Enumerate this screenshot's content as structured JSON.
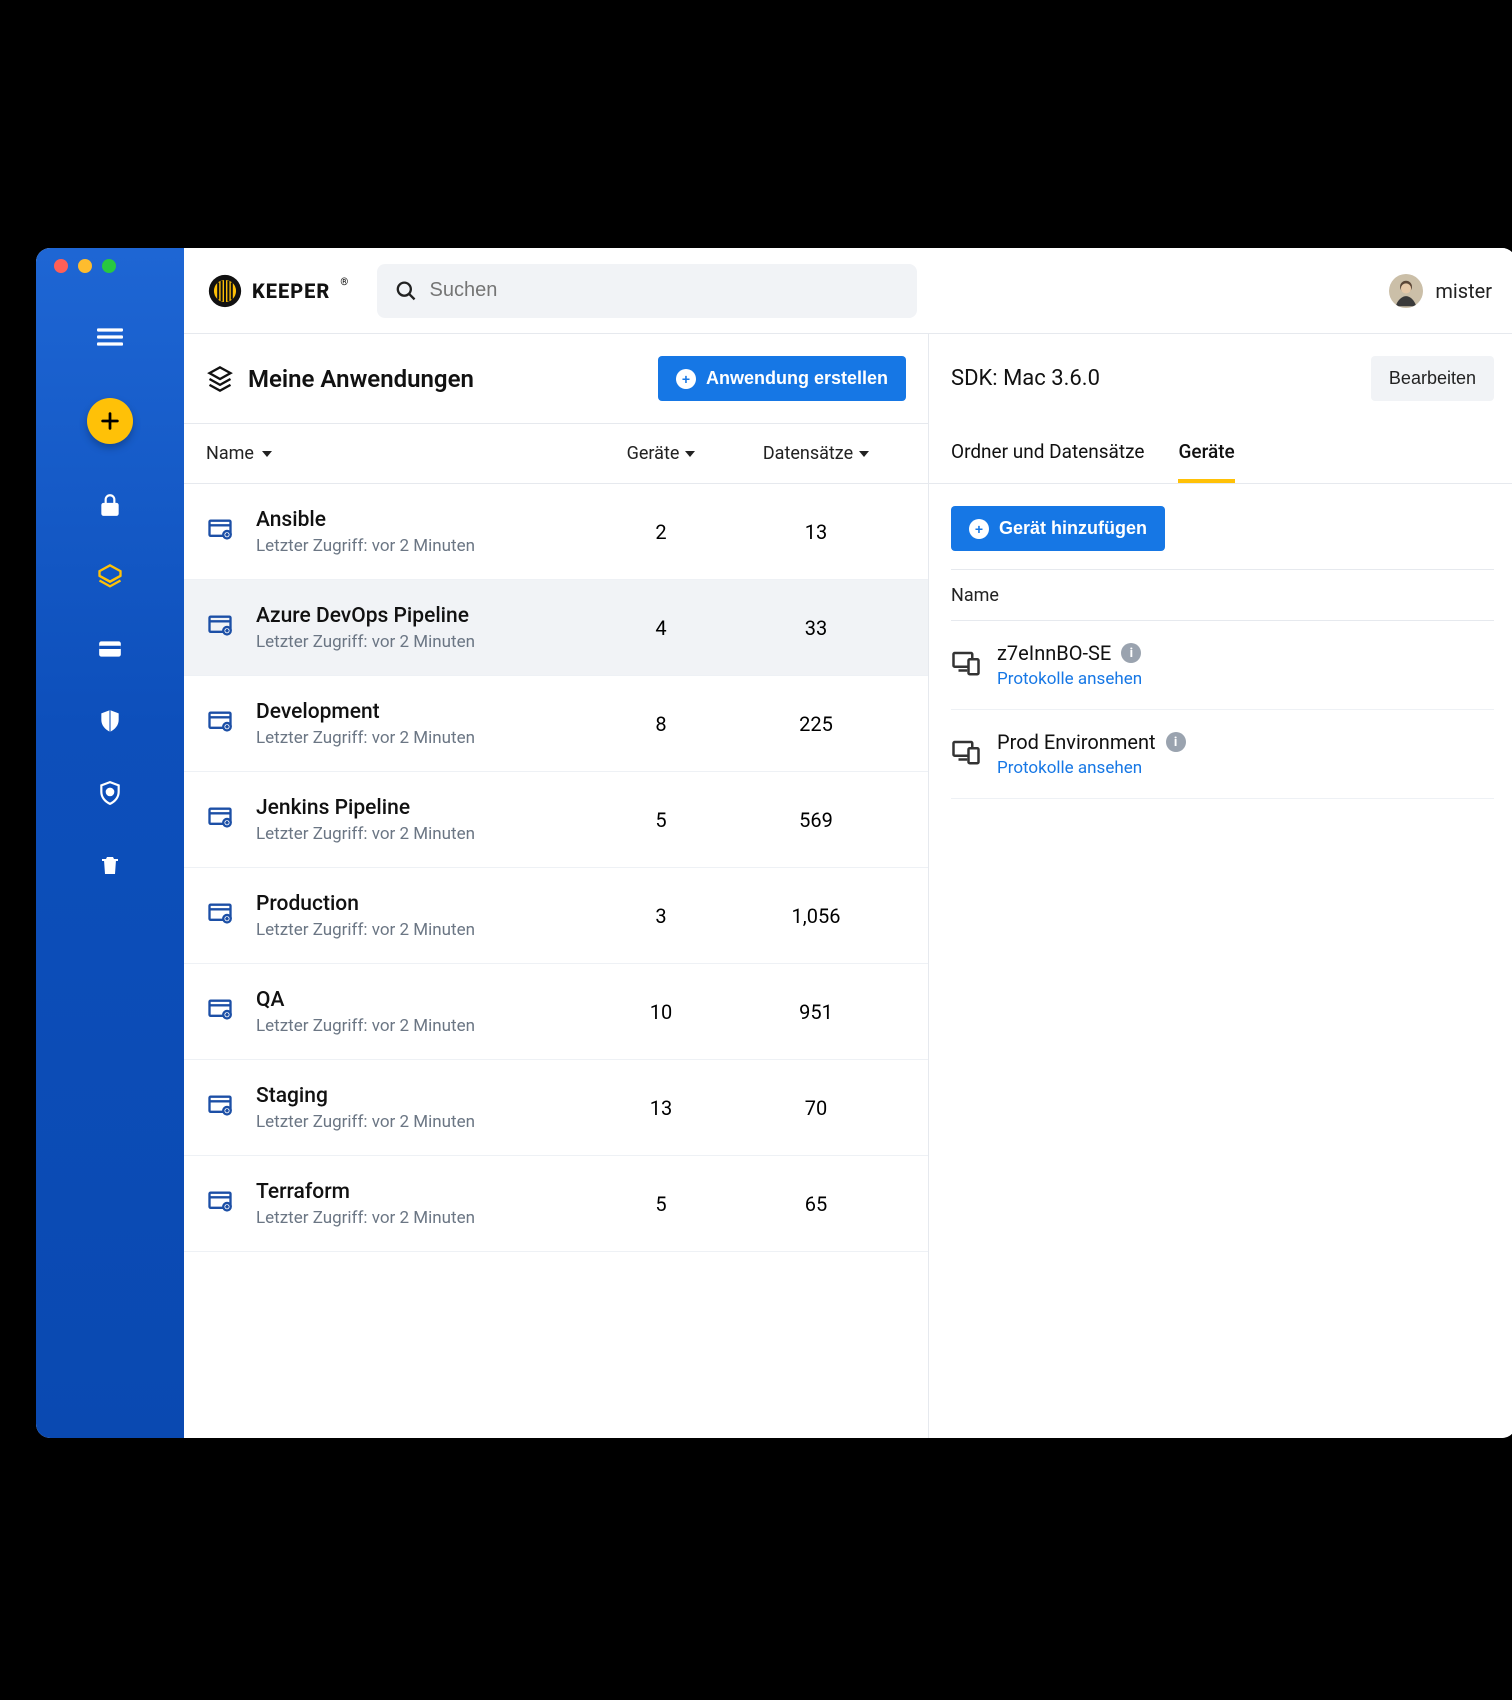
{
  "brand": "KEEPER",
  "search": {
    "placeholder": "Suchen"
  },
  "user": {
    "name": "mister"
  },
  "left": {
    "title": "Meine Anwendungen",
    "create_label": "Anwendung erstellen",
    "columns": {
      "name": "Name",
      "devices": "Geräte",
      "records": "Datensätze"
    },
    "rows": [
      {
        "name": "Ansible",
        "sub": "Letzter Zugriff: vor 2 Minuten",
        "devices": "2",
        "records": "13",
        "selected": false
      },
      {
        "name": "Azure DevOps Pipeline",
        "sub": "Letzter Zugriff: vor 2 Minuten",
        "devices": "4",
        "records": "33",
        "selected": true
      },
      {
        "name": "Development",
        "sub": "Letzter Zugriff: vor 2 Minuten",
        "devices": "8",
        "records": "225",
        "selected": false
      },
      {
        "name": "Jenkins Pipeline",
        "sub": "Letzter Zugriff: vor 2 Minuten",
        "devices": "5",
        "records": "569",
        "selected": false
      },
      {
        "name": "Production",
        "sub": "Letzter Zugriff: vor 2 Minuten",
        "devices": "3",
        "records": "1,056",
        "selected": false
      },
      {
        "name": "QA",
        "sub": "Letzter Zugriff: vor 2 Minuten",
        "devices": "10",
        "records": "951",
        "selected": false
      },
      {
        "name": "Staging",
        "sub": "Letzter Zugriff: vor 2 Minuten",
        "devices": "13",
        "records": "70",
        "selected": false
      },
      {
        "name": "Terraform",
        "sub": "Letzter Zugriff: vor 2 Minuten",
        "devices": "5",
        "records": "65",
        "selected": false
      }
    ]
  },
  "right": {
    "title": "SDK: Mac 3.6.0",
    "edit_label": "Bearbeiten",
    "tabs": [
      {
        "label": "Ordner und Datensätze",
        "active": false
      },
      {
        "label": "Geräte",
        "active": true
      }
    ],
    "add_device_label": "Gerät hinzufügen",
    "dev_col_name": "Name",
    "devices": [
      {
        "name": "z7eInnBO-SE",
        "link": "Protokolle ansehen"
      },
      {
        "name": "Prod Environment",
        "link": "Protokolle ansehen"
      }
    ]
  }
}
